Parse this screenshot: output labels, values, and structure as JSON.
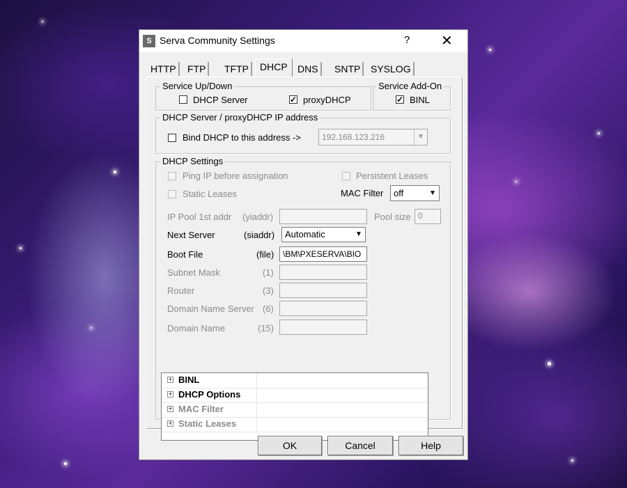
{
  "window": {
    "title": "Serva Community Settings",
    "help_glyph": "?",
    "close_glyph": "✕"
  },
  "tabs": [
    {
      "label": "HTTP"
    },
    {
      "label": "FTP"
    },
    {
      "label": "TFTP"
    },
    {
      "label": "DHCP",
      "active": true
    },
    {
      "label": "DNS"
    },
    {
      "label": "SNTP"
    },
    {
      "label": "SYSLOG"
    }
  ],
  "service_updown": {
    "title": "Service Up/Down",
    "dhcp_server": "DHCP Server",
    "proxy_dhcp": "proxyDHCP"
  },
  "service_addon": {
    "title": "Service Add-On",
    "binl": "BINL"
  },
  "ip_address": {
    "title": "DHCP Server / proxyDHCP IP address",
    "bind_label": "Bind DHCP to this address  ->",
    "value": "192.168.123.216"
  },
  "dhcp_settings": {
    "title": "DHCP Settings",
    "ping_ip": "Ping IP before assignation",
    "persistent": "Persistent Leases",
    "static_leases": "Static Leases",
    "mac_filter_label": "MAC Filter",
    "mac_filter_value": "off",
    "ip_pool_label": "IP Pool 1st addr",
    "ip_pool_code": "(yiaddr)",
    "pool_size_label": "Pool size",
    "pool_size_value": "0",
    "next_server_label": "Next Server",
    "next_server_code": "(siaddr)",
    "next_server_value": "Automatic",
    "boot_file_label": "Boot File",
    "boot_file_code": "(file)",
    "boot_file_value": "\\BM\\PXESERVA\\BIO",
    "subnet_label": "Subnet Mask",
    "subnet_code": "(1)",
    "router_label": "Router",
    "router_code": "(3)",
    "dns_label": "Domain Name Server",
    "dns_code": "(6)",
    "domain_label": "Domain Name",
    "domain_code": "(15)"
  },
  "tree": [
    {
      "label": "BINL",
      "enabled": true
    },
    {
      "label": "DHCP Options",
      "enabled": true
    },
    {
      "label": "MAC Filter",
      "enabled": false
    },
    {
      "label": "Static Leases",
      "enabled": false
    }
  ],
  "buttons": {
    "ok": "OK",
    "cancel": "Cancel",
    "help": "Help"
  },
  "icons": {
    "app": "S",
    "plus": "+",
    "check": "✓",
    "dropdown": "▼"
  }
}
